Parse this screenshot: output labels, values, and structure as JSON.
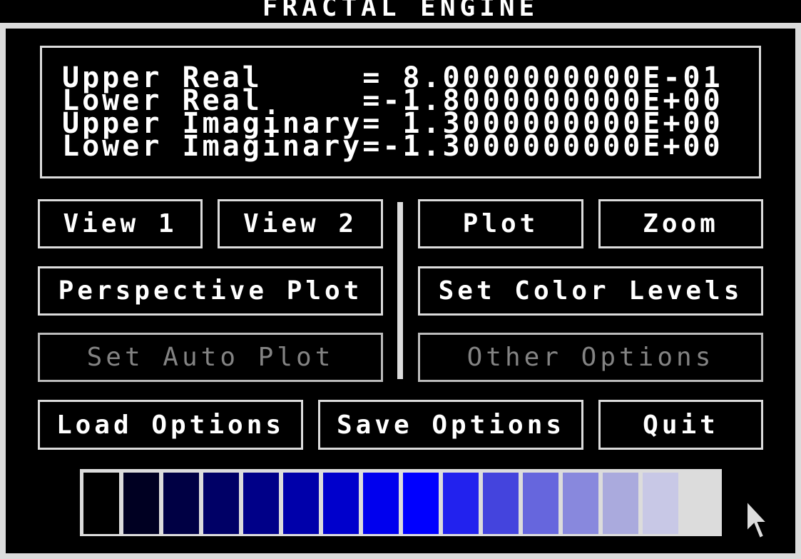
{
  "app": {
    "title": "FRACTAL ENGINE"
  },
  "readout": {
    "rows": [
      {
        "label": "Upper Real     =",
        "value": " 8.0000000000E-01"
      },
      {
        "label": "Lower Real     =",
        "value": "-1.8000000000E+00"
      },
      {
        "label": "Upper Imaginary=",
        "value": " 1.3000000000E+00"
      },
      {
        "label": "Lower Imaginary=",
        "value": "-1.3000000000E+00"
      }
    ]
  },
  "buttons": {
    "view1": "View 1",
    "view2": "View 2",
    "plot": "Plot",
    "zoom": "Zoom",
    "perspective_plot": "Perspective Plot",
    "set_color_levels": "Set Color Levels",
    "set_auto_plot": "Set Auto Plot",
    "other_options": "Other Options",
    "load_options": "Load Options",
    "save_options": "Save Options",
    "quit": "Quit"
  },
  "palette": {
    "colors": [
      "#000000",
      "#000022",
      "#000044",
      "#000066",
      "#000088",
      "#0000aa",
      "#0000cc",
      "#0000ee",
      "#0000ff",
      "#2222ee",
      "#4444dd",
      "#6666dd",
      "#8888dd",
      "#aaaadd",
      "#c8c8e6",
      "#dcdcdc"
    ]
  },
  "colors": {
    "background": "#000000",
    "foreground": "#ffffff",
    "frame": "#dcdcdc",
    "disabled_text": "#9a9a9a"
  },
  "icons": {
    "cursor": "mouse-pointer-icon"
  }
}
